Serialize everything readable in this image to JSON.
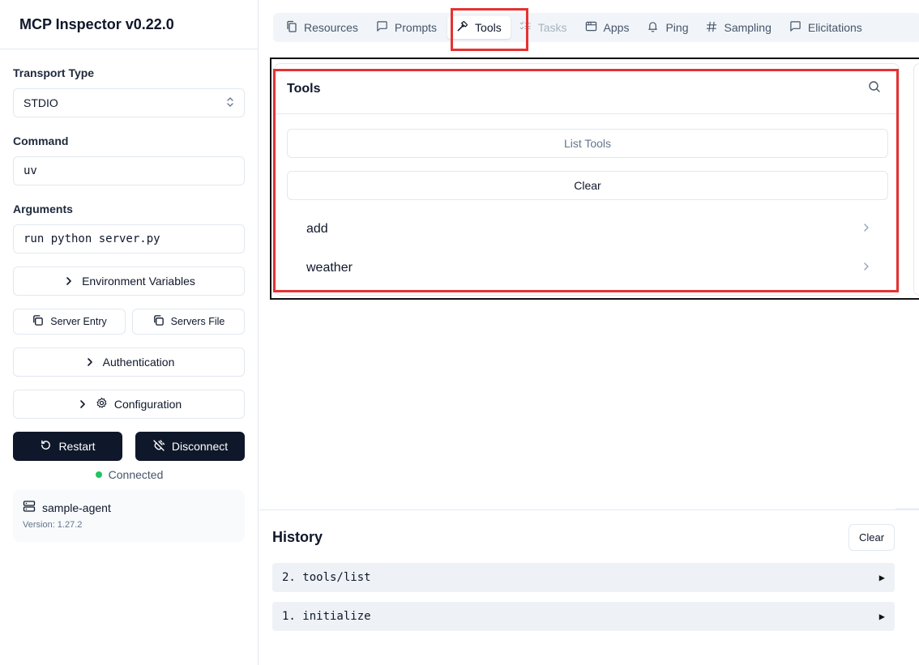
{
  "app": {
    "title": "MCP Inspector v0.22.0"
  },
  "sidebar": {
    "transport_label": "Transport Type",
    "transport_value": "STDIO",
    "command_label": "Command",
    "command_value": "uv",
    "arguments_label": "Arguments",
    "arguments_value": "run python server.py",
    "env_vars_label": "Environment Variables",
    "server_entry_label": "Server Entry",
    "servers_file_label": "Servers File",
    "authentication_label": "Authentication",
    "configuration_label": "Configuration",
    "restart_label": "Restart",
    "disconnect_label": "Disconnect",
    "status_text": "Connected",
    "status_color": "#22c55e",
    "server_name": "sample-agent",
    "server_version": "Version: 1.27.2"
  },
  "tabs": [
    {
      "label": "Resources",
      "icon": "files-icon",
      "state": "normal"
    },
    {
      "label": "Prompts",
      "icon": "message-icon",
      "state": "normal"
    },
    {
      "label": "Tools",
      "icon": "hammer-icon",
      "state": "active"
    },
    {
      "label": "Tasks",
      "icon": "list-checks-icon",
      "state": "disabled"
    },
    {
      "label": "Apps",
      "icon": "app-window-icon",
      "state": "normal"
    },
    {
      "label": "Ping",
      "icon": "bell-icon",
      "state": "normal"
    },
    {
      "label": "Sampling",
      "icon": "hash-icon",
      "state": "normal"
    },
    {
      "label": "Elicitations",
      "icon": "message-icon",
      "state": "normal"
    }
  ],
  "tools_panel": {
    "title": "Tools",
    "list_tools_label": "List Tools",
    "clear_label": "Clear",
    "items": [
      "add",
      "weather"
    ]
  },
  "history": {
    "title": "History",
    "clear_label": "Clear",
    "entries": [
      "2. tools/list",
      "1. initialize"
    ]
  },
  "colors": {
    "highlight_red": "#e53232",
    "dark_button": "#0f172a",
    "tab_bar_bg": "#f1f5f9",
    "history_row_bg": "#eef2f6"
  }
}
